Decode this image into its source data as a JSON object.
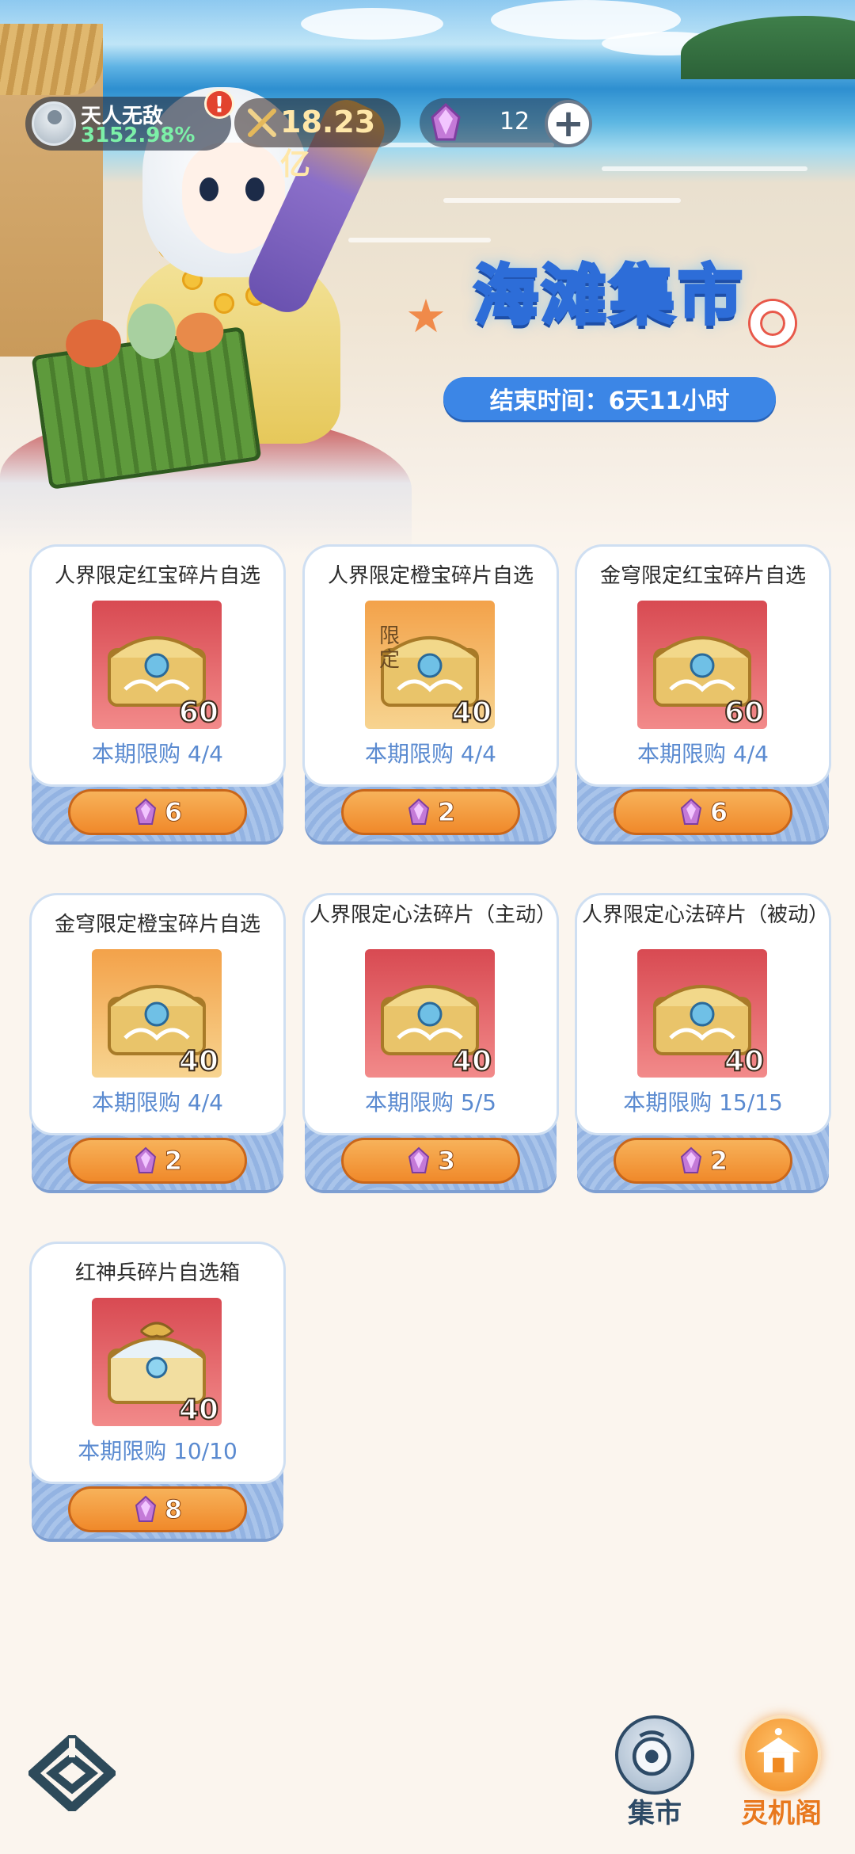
{
  "status": {
    "rank_name": "天人无敌",
    "rank_percent": "3152.98%",
    "alert_mark": "!",
    "power_value": "18.23亿",
    "gem_count": "12",
    "plus_label": "+"
  },
  "event": {
    "title": "海滩集市",
    "timer_label": "结束时间：6天11小时"
  },
  "items": [
    {
      "name": "人界限定红宝碎片自选",
      "qty": "60",
      "limit": "本期限购 4/4",
      "price": "6",
      "tag": ""
    },
    {
      "name": "人界限定橙宝碎片自选",
      "qty": "40",
      "limit": "本期限购 4/4",
      "price": "2",
      "tag": "限定"
    },
    {
      "name": "金穹限定红宝碎片自选",
      "qty": "60",
      "limit": "本期限购 4/4",
      "price": "6",
      "tag": ""
    },
    {
      "name": "金穹限定橙宝碎片自选",
      "qty": "40",
      "limit": "本期限购 4/4",
      "price": "2",
      "tag": ""
    },
    {
      "name": "人界限定心法碎片（主动）",
      "qty": "40",
      "limit": "本期限购 5/5",
      "price": "3",
      "tag": ""
    },
    {
      "name": "人界限定心法碎片（被动）",
      "qty": "40",
      "limit": "本期限购 15/15",
      "price": "2",
      "tag": ""
    },
    {
      "name": "红神兵碎片自选箱",
      "qty": "40",
      "limit": "本期限购 10/10",
      "price": "8",
      "tag": ""
    }
  ],
  "nav": {
    "market_label": "集市",
    "lingji_label": "灵机阁"
  },
  "colors": {
    "accent_blue": "#3c86e6",
    "button_orange": "#f0892a",
    "limit_text": "#5a8ad0",
    "nav_active": "#e8781e",
    "nav_inactive": "#2d4a66"
  }
}
